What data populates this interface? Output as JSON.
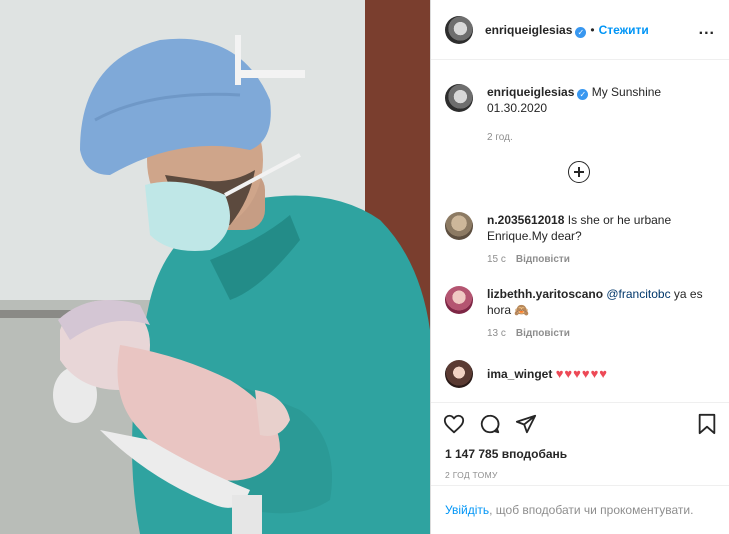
{
  "post": {
    "author": "enriqueiglesias",
    "separator": "•",
    "follow_label": "Стежити",
    "more_label": "...",
    "caption_text": "My Sunshine 01.30.2020",
    "caption_time": "2 год."
  },
  "comments": [
    {
      "username": "n.2035612018",
      "text": "Is she or he urbane Enrique.My dear?",
      "time": "15 с",
      "reply_label": "Відповісти"
    },
    {
      "username": "lizbethh.yaritoscano",
      "mention": "@francitobc",
      "text": " ya es hora 🙈",
      "time": "13 с",
      "reply_label": "Відповісти"
    },
    {
      "username": "ima_winget",
      "text": "♥♥♥♥♥♥"
    }
  ],
  "actions": {
    "likes": "1 147 785 вподобань",
    "posted_ago": "2 ГОД ТОМУ",
    "login_link": "Увійдіть",
    "login_text": ", щоб вподобати чи прокоментувати."
  },
  "colors": {
    "accent": "#0095f6",
    "heart": "#ed4956",
    "scrubs": "#2fa3a0",
    "cap": "#7fa9d8"
  },
  "icons": [
    "verified-badge-icon",
    "more-options-icon",
    "load-more-comments-icon",
    "like-heart-icon",
    "comment-icon",
    "share-icon",
    "save-bookmark-icon"
  ]
}
